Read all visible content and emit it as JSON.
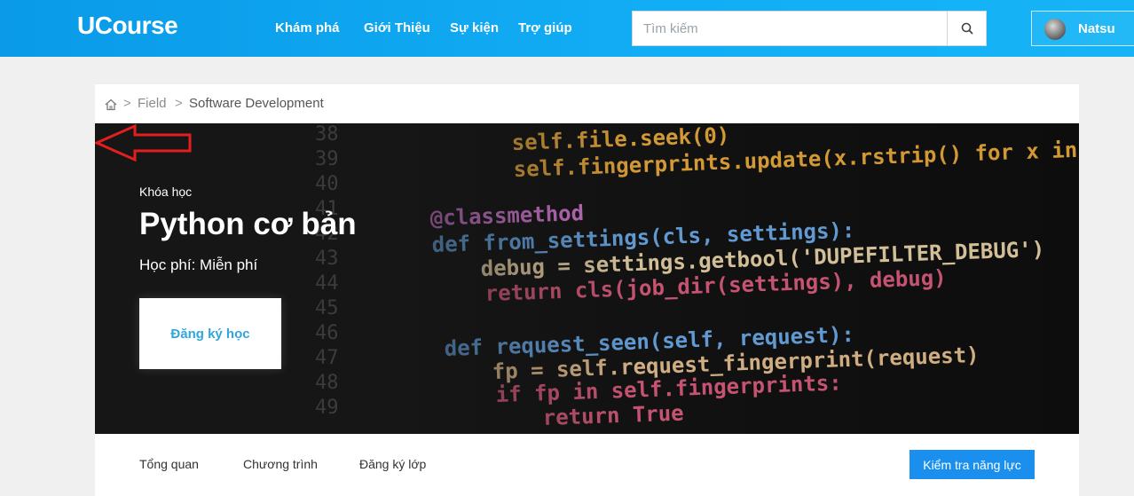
{
  "header": {
    "logo": "UCourse",
    "nav": [
      "Khám phá",
      "Giới Thiệu",
      "Sự kiện",
      "Trợ giúp"
    ],
    "search_placeholder": "Tìm kiếm",
    "user_name": "Natsu"
  },
  "breadcrumb": {
    "home_icon": "home-icon",
    "sep": ">",
    "items": [
      "Field",
      "Software Development"
    ]
  },
  "hero": {
    "label": "Khóa học",
    "title": "Python cơ bản",
    "fee": "Học phí: Miễn phí",
    "register_label": "Đăng ký học",
    "code_lines": [
      "38",
      "39",
      "40",
      "41",
      "42",
      "43",
      "44",
      "45",
      "46",
      "47",
      "48",
      "49"
    ],
    "code_text": [
      "self.file.seek(0)",
      "self.fingerprints.update(x.rstrip() for x in self.file)",
      "@classmethod",
      "def from_settings(cls, settings):",
      "debug = settings.getbool('DUPEFILTER_DEBUG')",
      "return cls(job_dir(settings), debug)",
      "def request_seen(self, request):",
      "fp = self.request_fingerprint(request)",
      "if fp in self.fingerprints:",
      "return True"
    ]
  },
  "tabs": [
    "Tổng quan",
    "Chương trình",
    "Đăng ký lớp"
  ],
  "assess_label": "Kiểm tra năng lực",
  "colors": {
    "header": "#12aef5",
    "accent": "#1a8fee",
    "register_text": "#2fa6dd",
    "arrow": "#e41e1e"
  }
}
